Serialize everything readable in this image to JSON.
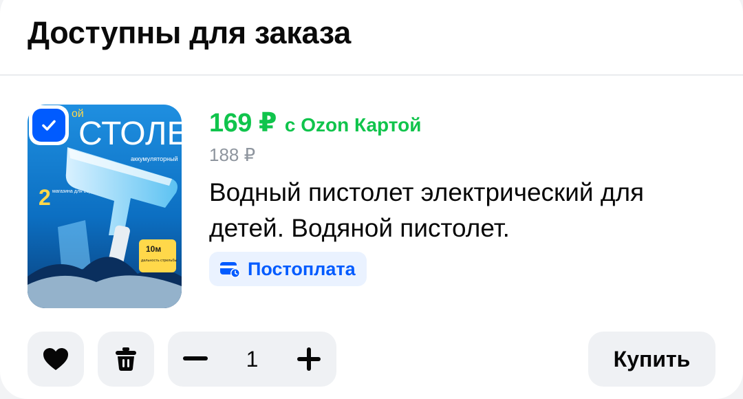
{
  "section": {
    "title": "Доступны для заказа"
  },
  "product": {
    "price": "169 ₽",
    "price_card_label": "с Ozon Картой",
    "old_price": "188 ₽",
    "title": "Водный пистолет электрический для детей. Водяной пистолет.",
    "badge": {
      "label": "Постоплата",
      "icon": "wallet-clock-icon"
    },
    "selected": true,
    "image": {
      "text_big": "СТОЛЕТ",
      "text_sub": "аккумуляторный",
      "text_corner": "ой",
      "text_magazines_num": "2",
      "text_magazines": "магазина для воды",
      "text_range_big": "10м",
      "text_range": "дальность стрельбы"
    }
  },
  "controls": {
    "favorite_icon": "heart-icon",
    "delete_icon": "trash-icon",
    "quantity": "1",
    "buy_label": "Купить"
  },
  "colors": {
    "green_price": "#10c44c",
    "brand_blue": "#005bff",
    "badge_bg": "#eaf2ff",
    "control_bg": "#eff1f4",
    "old_price": "#8e959e"
  }
}
